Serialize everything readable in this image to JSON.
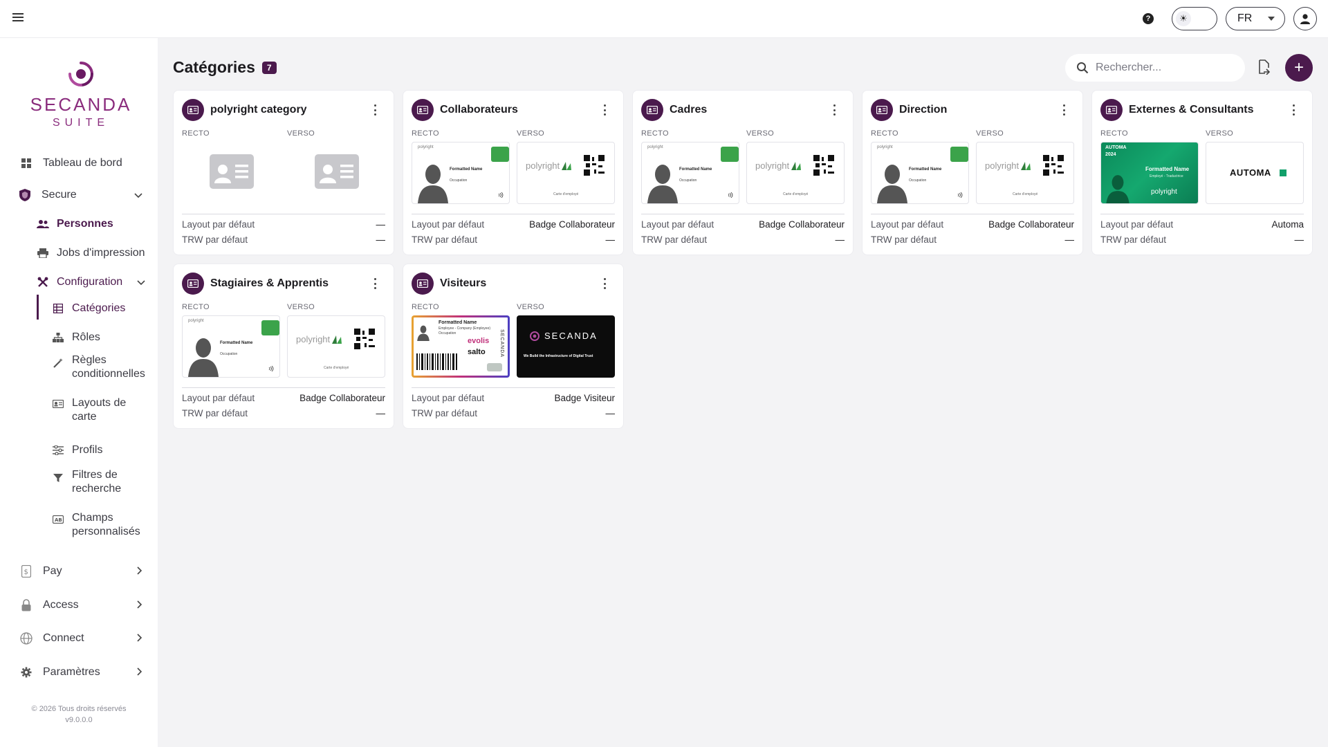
{
  "header": {
    "language": "FR"
  },
  "logo": {
    "name": "SECANDA",
    "tagline": "SUITE"
  },
  "nav": {
    "items": [
      {
        "label": "Tableau de bord",
        "icon": "dashboard-icon"
      },
      {
        "label": "Secure",
        "icon": "shield-icon"
      },
      {
        "label": "Personnes",
        "icon": "people-icon"
      },
      {
        "label": "Jobs d'impression",
        "icon": "printer-icon"
      },
      {
        "label": "Configuration",
        "icon": "tools-icon"
      },
      {
        "label": "Catégories",
        "icon": "grid-icon"
      },
      {
        "label": "Rôles",
        "icon": "hierarchy-icon"
      },
      {
        "label_line1": "Règles",
        "label_line2": "conditionnelles",
        "icon": "magic-wand-icon"
      },
      {
        "label_line1": "Layouts de",
        "label_line2": "carte",
        "icon": "id-card-icon"
      },
      {
        "label": "Profils",
        "icon": "sliders-icon"
      },
      {
        "label_line1": "Filtres de",
        "label_line2": "recherche",
        "icon": "filter-icon"
      },
      {
        "label_line1": "Champs",
        "label_line2": "personnalisés",
        "icon": "custom-field-icon"
      },
      {
        "label": "Pay",
        "icon": "wallet-icon"
      },
      {
        "label": "Access",
        "icon": "lock-icon"
      },
      {
        "label": "Connect",
        "icon": "globe-icon"
      },
      {
        "label": "Paramètres",
        "icon": "gear-icon"
      }
    ]
  },
  "footer": {
    "copyright": "© 2026 Tous droits réservés",
    "version": "v9.0.0.0"
  },
  "main": {
    "title": "Catégories",
    "count": "7",
    "search_placeholder": "Rechercher...",
    "recto_label": "RECTO",
    "verso_label": "VERSO",
    "layout_label": "Layout par défaut",
    "trw_label": "TRW par défaut",
    "categories": [
      {
        "name": "polyright category",
        "layout": "—",
        "trw": "—",
        "front": "empty",
        "back": "empty"
      },
      {
        "name": "Collaborateurs",
        "layout": "Badge Collaborateur",
        "trw": "—",
        "front": "polyright-front",
        "back": "polyright-back"
      },
      {
        "name": "Cadres",
        "layout": "Badge Collaborateur",
        "trw": "—",
        "front": "polyright-front",
        "back": "polyright-back"
      },
      {
        "name": "Direction",
        "layout": "Badge Collaborateur",
        "trw": "—",
        "front": "polyright-front",
        "back": "polyright-back"
      },
      {
        "name": "Externes & Consultants",
        "layout": "Automa",
        "trw": "—",
        "front": "automa-front",
        "back": "automa-back"
      },
      {
        "name": "Stagiaires & Apprentis",
        "layout": "Badge Collaborateur",
        "trw": "—",
        "front": "polyright-front",
        "back": "polyright-back"
      },
      {
        "name": "Visiteurs",
        "layout": "Badge Visiteur",
        "trw": "—",
        "front": "visitor-front",
        "back": "secanda-back"
      }
    ]
  },
  "card_art": {
    "polyright": "polyright",
    "formatted_name": "Formatted Name",
    "occupation": "Occupation",
    "carte_label": "Carte d'employé",
    "automa_logo": "AUTOMA",
    "automa_year": "2024",
    "automa_role": "Employé - Traductrice",
    "secanda_word": "SECANDA",
    "secanda_slogan": "We Build the Infrastructure of Digital Trust",
    "visitor_sub": "Employee - Company (Employee)",
    "evolis": "evolis",
    "salto": "salto"
  }
}
